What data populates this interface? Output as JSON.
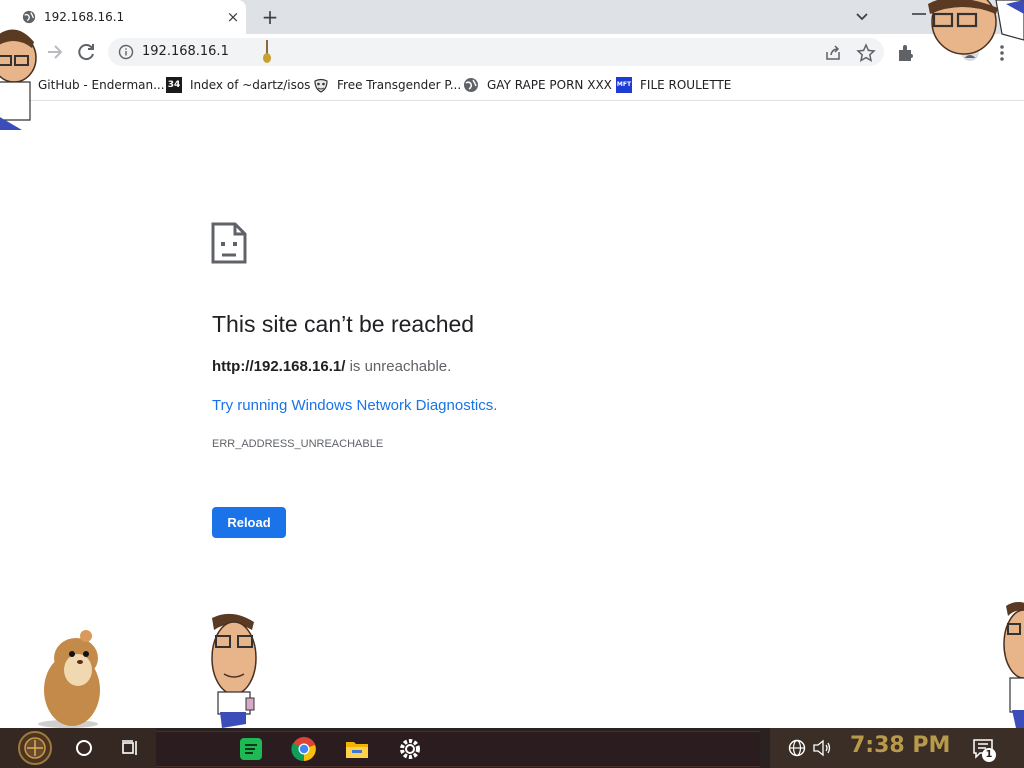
{
  "tab": {
    "title": "192.168.16.1",
    "close_glyph": "×",
    "new_tab_glyph": "+"
  },
  "toolbar": {
    "url": "192.168.16.1",
    "icons": [
      "back-icon",
      "forward-icon",
      "reload-icon",
      "info-icon",
      "share-icon",
      "bookmark-star-icon",
      "extensions-icon",
      "profile-icon",
      "menu-icon"
    ]
  },
  "bookmarks": [
    {
      "label": "GitHub - Enderman...",
      "icon": "github-icon"
    },
    {
      "label": "Index of ~dartz/isos",
      "icon": "34-icon",
      "icon_text": "34"
    },
    {
      "label": "Free Transgender P...",
      "icon": "mask-icon"
    },
    {
      "label": "GAY RAPE PORN XXX",
      "icon": "globe-icon"
    },
    {
      "label": "FILE ROULETTE",
      "icon": "mft-icon",
      "icon_text": "MFT"
    }
  ],
  "error": {
    "title": "This site can’t be reached",
    "url_bold": "http://192.168.16.1/",
    "desc_suffix": " is unreachable.",
    "link": "Try running Windows Network Diagnostics",
    "link_suffix": ".",
    "code": "ERR_ADDRESS_UNREACHABLE",
    "button": "Reload"
  },
  "taskbar": {
    "clock": "7:38 PM",
    "notification_count": "1",
    "apps": [
      "spotify-icon",
      "chrome-icon",
      "file-explorer-icon",
      "settings-icon"
    ]
  },
  "colors": {
    "accent": "#1a73e8",
    "tabstrip": "#dee1e6",
    "clock": "#b89a4a",
    "taskbar": "#2a2220"
  }
}
